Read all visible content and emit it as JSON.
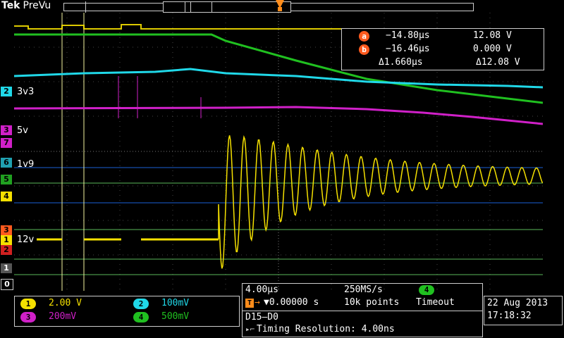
{
  "header": {
    "brand": "Tek",
    "mode": "PreVu"
  },
  "cursors": {
    "a_label": "a",
    "b_label": "b",
    "trigger_label": "T",
    "readout": {
      "a": {
        "time": "−14.80µs",
        "value": "12.08 V"
      },
      "b": {
        "time": "−16.46µs",
        "value": "0.000 V"
      },
      "delta": {
        "time": "Δ1.660µs",
        "value": "Δ12.08 V"
      }
    }
  },
  "trace_labels": {
    "ch2": "3v3",
    "ch3": "5v",
    "ch6": "1v9",
    "ch1": "12v"
  },
  "channels": [
    {
      "id": "1",
      "scale": "2.00 V",
      "color": "#f5e000"
    },
    {
      "id": "2",
      "scale": "100mV",
      "color": "#20d8e8"
    },
    {
      "id": "3",
      "scale": "200mV",
      "color": "#d020c8"
    },
    {
      "id": "4",
      "scale": "500mV",
      "color": "#20c020"
    }
  ],
  "horizontal": {
    "timebase": "4.00µs",
    "sample_rate": "250MS/s",
    "trigger_position": "▼0.00000 s",
    "record_length": "10k points",
    "trigger_channel": "4",
    "trigger_status": "Timeout"
  },
  "digital": {
    "group": "D15–D0",
    "timing_resolution": "Timing Resolution: 4.00ns"
  },
  "datetime": {
    "date": "22 Aug 2013",
    "time": "17:18:32"
  },
  "left_channel_indicators": [
    "2",
    "3",
    "7",
    "6",
    "5",
    "4",
    "3",
    "1",
    "2",
    "1",
    "0"
  ]
}
